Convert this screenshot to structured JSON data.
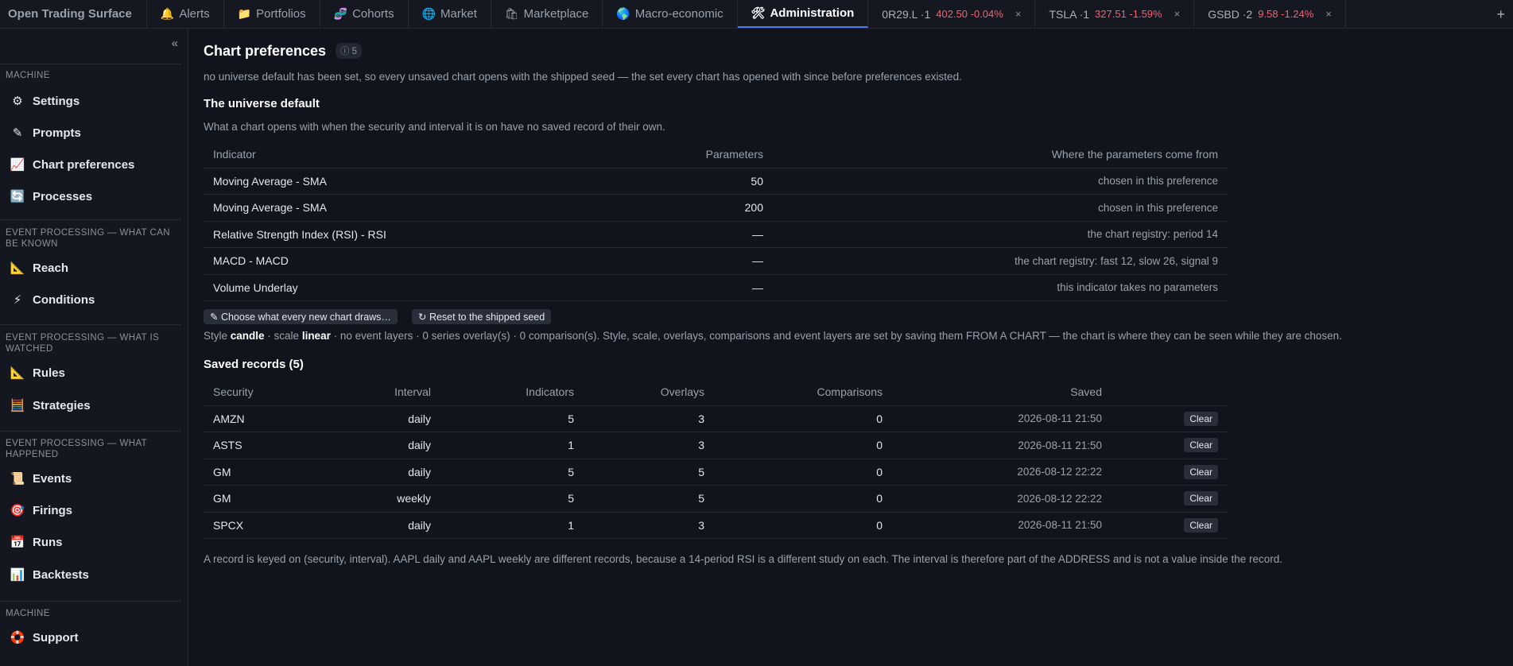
{
  "app": {
    "title": "Open Trading Surface"
  },
  "tabs": [
    {
      "icon": "🔔",
      "label": "Alerts"
    },
    {
      "icon": "📁",
      "label": "Portfolios"
    },
    {
      "icon": "🧬",
      "label": "Cohorts"
    },
    {
      "icon": "🌐",
      "label": "Market"
    },
    {
      "icon": "🛍",
      "label": "Marketplace"
    },
    {
      "icon": "🌎",
      "label": "Macro-economic"
    },
    {
      "icon": "🛠",
      "label": "Administration"
    }
  ],
  "security_tabs": [
    {
      "label": "0R29.L ·1",
      "quote": "402.50 -0.04%",
      "close": "×"
    },
    {
      "label": "TSLA ·1",
      "quote": "327.51 -1.59%",
      "close": "×"
    },
    {
      "label": "GSBD ·2",
      "quote": "9.58 -1.24%",
      "close": "×"
    }
  ],
  "add_tab": "+",
  "colors": {
    "accent": "#4a7cf0",
    "negative": "#f0626e",
    "background": "#11141c"
  },
  "sidebar": {
    "collapse": "«",
    "groups": [
      {
        "label": "MACHINE"
      },
      {
        "label": "EVENT PROCESSING — WHAT CAN BE KNOWN"
      },
      {
        "label": "EVENT PROCESSING — WHAT IS WATCHED"
      },
      {
        "label": "EVENT PROCESSING — WHAT HAPPENED"
      },
      {
        "label": "MACHINE"
      }
    ],
    "items": [
      {
        "icon": "⚙",
        "label": "Settings"
      },
      {
        "icon": "✎",
        "label": "Prompts"
      },
      {
        "icon": "📈",
        "label": "Chart preferences"
      },
      {
        "icon": "🔄",
        "label": "Processes"
      },
      {
        "icon": "📐",
        "label": "Reach"
      },
      {
        "icon": "⚡",
        "label": "Conditions"
      },
      {
        "icon": "📐",
        "label": "Rules"
      },
      {
        "icon": "🧮",
        "label": "Strategies"
      },
      {
        "icon": "📜",
        "label": "Events"
      },
      {
        "icon": "🎯",
        "label": "Firings"
      },
      {
        "icon": "📅",
        "label": "Runs"
      },
      {
        "icon": "📊",
        "label": "Backtests"
      },
      {
        "icon": "🛟",
        "label": "Support"
      }
    ]
  },
  "page": {
    "title": "Chart preferences",
    "badge": "ⓘ 5",
    "intro": "no universe default has been set, so every unsaved chart opens with the shipped seed — the set every chart has opened with since before preferences existed.",
    "universe": {
      "heading": "The universe default",
      "description": "What a chart opens with when the security and interval it is on have no saved record of their own.",
      "columns": [
        "Indicator",
        "Parameters",
        "Where the parameters come from"
      ],
      "rows": [
        {
          "indicator": "Moving Average - SMA",
          "params": "50",
          "source": "chosen in this preference"
        },
        {
          "indicator": "Moving Average - SMA",
          "params": "200",
          "source": "chosen in this preference"
        },
        {
          "indicator": "Relative Strength Index (RSI) - RSI",
          "params": "—",
          "source": "the chart registry: period 14"
        },
        {
          "indicator": "MACD - MACD",
          "params": "—",
          "source": "the chart registry: fast 12, slow 26, signal 9"
        },
        {
          "indicator": "Volume Underlay",
          "params": "—",
          "source": "this indicator takes no parameters"
        }
      ],
      "choose_button": "✎ Choose what every new chart draws…",
      "reset_button": "↻ Reset to the shipped seed",
      "style_prefix": "Style ",
      "style_value": "candle",
      "scale_prefix": " · scale ",
      "scale_value": "linear",
      "style_suffix": " · no event layers · 0 series overlay(s) · 0 comparison(s). Style, scale, overlays, comparisons and event layers are set by saving them FROM A CHART — the chart is where they can be seen while they are chosen."
    },
    "saved": {
      "heading": "Saved records (5)",
      "columns": [
        "Security",
        "Interval",
        "Indicators",
        "Overlays",
        "Comparisons",
        "Saved",
        ""
      ],
      "rows": [
        {
          "security": "AMZN",
          "interval": "daily",
          "indicators": "5",
          "overlays": "3",
          "comparisons": "0",
          "saved": "2026-08-11 21:50",
          "action": "Clear"
        },
        {
          "security": "ASTS",
          "interval": "daily",
          "indicators": "1",
          "overlays": "3",
          "comparisons": "0",
          "saved": "2026-08-11 21:50",
          "action": "Clear"
        },
        {
          "security": "GM",
          "interval": "daily",
          "indicators": "5",
          "overlays": "5",
          "comparisons": "0",
          "saved": "2026-08-12 22:22",
          "action": "Clear"
        },
        {
          "security": "GM",
          "interval": "weekly",
          "indicators": "5",
          "overlays": "5",
          "comparisons": "0",
          "saved": "2026-08-12 22:22",
          "action": "Clear"
        },
        {
          "security": "SPCX",
          "interval": "daily",
          "indicators": "1",
          "overlays": "3",
          "comparisons": "0",
          "saved": "2026-08-11 21:50",
          "action": "Clear"
        }
      ],
      "footnote": "A record is keyed on (security, interval). AAPL daily and AAPL weekly are different records, because a 14-period RSI is a different study on each. The interval is therefore part of the ADDRESS and is not a value inside the record."
    }
  }
}
